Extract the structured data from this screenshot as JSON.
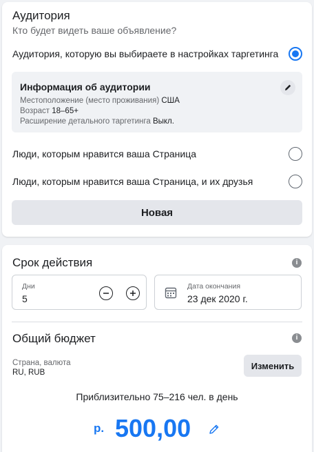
{
  "audience": {
    "title": "Аудитория",
    "subtitle": "Кто будет видеть ваше объявление?",
    "options": [
      {
        "label": "Аудитория, которую вы выбираете в настройках таргетинга",
        "selected": true
      },
      {
        "label": "Люди, которым нравится ваша Страница",
        "selected": false
      },
      {
        "label": "Люди, которым нравится ваша Страница, и их друзья",
        "selected": false
      }
    ],
    "info": {
      "title": "Информация об аудитории",
      "location_label": "Местоположение (место проживания)",
      "location_value": "США",
      "age_label": "Возраст",
      "age_value": "18–65+",
      "expansion_label": "Расширение детального таргетинга",
      "expansion_value": "Выкл."
    },
    "new_button": "Новая"
  },
  "duration": {
    "title": "Срок действия",
    "days_label": "Дни",
    "days_value": "5",
    "end_label": "Дата окончания",
    "end_value": "23 дек 2020 г."
  },
  "budget": {
    "title": "Общий бюджет",
    "country_label": "Страна, валюта",
    "country_value": "RU, RUB",
    "change_button": "Изменить",
    "estimate": "Приблизительно 75–216 чел. в день",
    "currency_symbol": "р.",
    "amount": "500,00"
  },
  "colors": {
    "accent": "#1877f2",
    "background": "#f0f2f5"
  }
}
